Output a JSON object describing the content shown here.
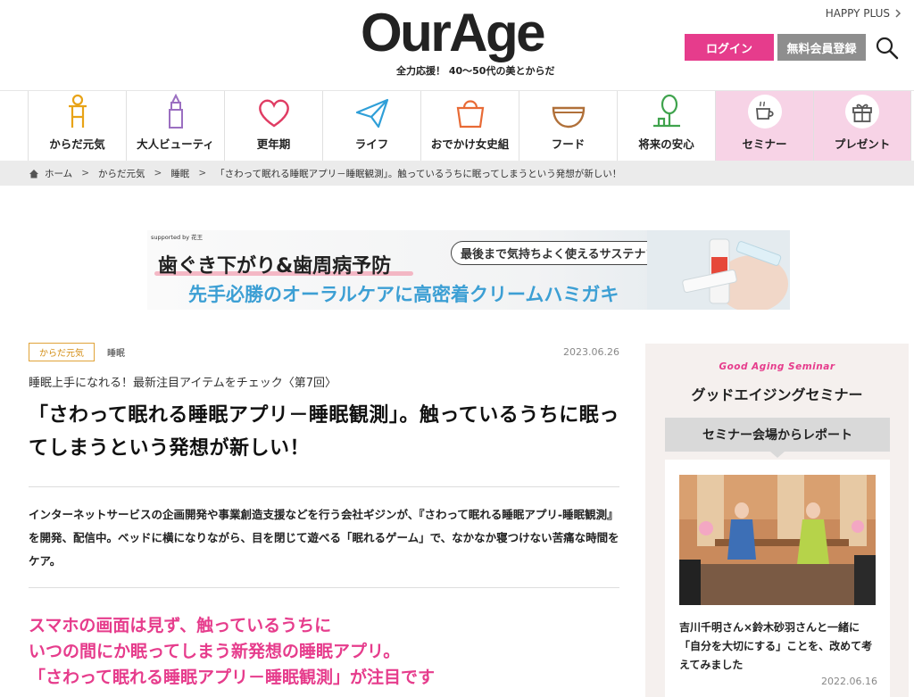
{
  "header": {
    "logo": "OurAge",
    "tagline": "全力応援！ 40〜50代の美とからだ",
    "happyplus": "HAPPY PLUS",
    "login": "ログイン",
    "register": "無料会員登録"
  },
  "nav": {
    "items": [
      {
        "label": "からだ元気",
        "icon": "person-icon"
      },
      {
        "label": "大人ビューティ",
        "icon": "lipstick-icon"
      },
      {
        "label": "更年期",
        "icon": "heart-icon"
      },
      {
        "label": "ライフ",
        "icon": "paper-plane-icon"
      },
      {
        "label": "おでかけ女史組",
        "icon": "bag-icon"
      },
      {
        "label": "フード",
        "icon": "bowl-icon"
      },
      {
        "label": "将来の安心",
        "icon": "tree-icon"
      },
      {
        "label": "セミナー",
        "icon": "cup-icon"
      },
      {
        "label": "プレゼント",
        "icon": "gift-icon"
      }
    ]
  },
  "breadcrumb": {
    "items": [
      "ホーム",
      "からだ元気",
      "睡眠",
      "「さわって眠れる睡眠アプリ－睡眠観測」。触っているうちに眠ってしまうという発想が新しい！"
    ]
  },
  "banner": {
    "supported": "supported by 花王",
    "line1": "歯ぐき下がり&歯周病予防",
    "line2": "先手必勝のオーラルケアに高密着クリームハミガキ",
    "note": "最後まで気持ちよく使えるサステナブル仕様"
  },
  "article": {
    "category": "からだ元気",
    "subcategory": "睡眠",
    "date": "2023.06.26",
    "series": "睡眠上手になれる！最新注目アイテムをチェック〈第7回〉",
    "title": "「さわって眠れる睡眠アプリ－睡眠観測」。触っているうちに眠ってしまうという発想が新しい！",
    "lead": "インターネットサービスの企画開発や事業創造支援などを行う会社ギジンが、『さわって眠れる睡眠アプリ-睡眠観測』を開発、配信中。ベッドに横になりながら、目を閉じて遊べる「眠れるゲーム」で、なかなか寝つけない苦痛な時間をケア。",
    "headline_lines": [
      "スマホの画面は見ず、触っているうちに",
      "いつの間にか眠ってしまう新発想の睡眠アプリ。",
      "「さわって眠れる睡眠アプリ－睡眠観測」が注目です"
    ]
  },
  "sidebar": {
    "en_title": "Good Aging Seminar",
    "title": "グッドエイジングセミナー",
    "tab": "セミナー会場からレポート",
    "card_caption": "吉川千明さん×鈴木砂羽さんと一緒に「自分を大切にする」ことを、改めて考えてみました",
    "card_date": "2022.06.16"
  },
  "colors": {
    "pink": "#e63c8c",
    "nav_pink": "#f7d3e6",
    "category_orange": "#d38d14",
    "breadcrumb_bg": "#ebebeb"
  }
}
